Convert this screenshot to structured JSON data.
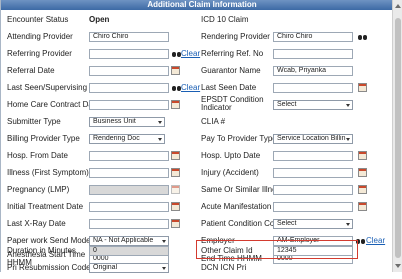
{
  "title": "Additional Claim Information",
  "clear_link": "Clear",
  "fields": {
    "encounter_status": {
      "label": "Encounter Status",
      "value": "Open"
    },
    "icd10_claim": {
      "label": "ICD 10 Claim"
    },
    "attending_provider": {
      "label": "Attending Provider",
      "value": "Chiro Chiro"
    },
    "rendering_provider": {
      "label": "Rendering Provider",
      "value": "Chiro Chiro"
    },
    "referring_provider": {
      "label": "Referring Provider",
      "value": ""
    },
    "referring_ref_no": {
      "label": "Referring Ref. No",
      "value": ""
    },
    "referral_date": {
      "label": "Referral Date",
      "value": ""
    },
    "guarantor_name": {
      "label": "Guarantor Name",
      "value": "Wcab, Priyanka"
    },
    "last_seen_supervising_doc": {
      "label": "Last Seen/Supervising Doc",
      "value": ""
    },
    "last_seen_date": {
      "label": "Last Seen Date",
      "value": ""
    },
    "home_care_contract_date": {
      "label": "Home Care Contract Date",
      "value": ""
    },
    "epsdt_condition_indicator": {
      "label": "EPSDT Condition Indicator",
      "value": "Select"
    },
    "submitter_type": {
      "label": "Submitter Type",
      "value": "Business Unit"
    },
    "clia": {
      "label": "CLIA #"
    },
    "billing_provider_type": {
      "label": "Billing Provider Type",
      "value": "Rendering Doc"
    },
    "pay_to_provider_type": {
      "label": "Pay To Provider Type",
      "value": "Service Location Billin"
    },
    "hosp_from_date": {
      "label": "Hosp. From Date",
      "value": ""
    },
    "hosp_upto_date": {
      "label": "Hosp. Upto Date",
      "value": ""
    },
    "illness_first_symptom": {
      "label": "Illness (First Symptom)",
      "value": ""
    },
    "injury_accident": {
      "label": "Injury (Accident)",
      "value": ""
    },
    "pregnancy_lmp": {
      "label": "Pregnancy (LMP)",
      "value": ""
    },
    "same_or_similar_illness": {
      "label": "Same Or Similar Illness",
      "value": ""
    },
    "initial_treatment_date": {
      "label": "Initial Treatment Date",
      "value": ""
    },
    "acute_manifestation_date": {
      "label": "Acute Manifestation Date",
      "value": ""
    },
    "last_xray_date": {
      "label": "Last X-Ray Date",
      "value": ""
    },
    "patient_condition_code": {
      "label": "Patient Condition Code",
      "value": "Select"
    },
    "paper_work_send_mode": {
      "label": "Paper work Send Mode",
      "value": "NA - Not Applicable"
    },
    "employer": {
      "label": "Employer",
      "value": "AM-Employer"
    },
    "anesthesia_start_time": {
      "label": "Anesthesia Start Time HHMM",
      "value": "0000"
    },
    "end_time": {
      "label": "End Time HHMM",
      "value": "0000"
    },
    "duration_in_minutes": {
      "label": "Duration in Minutes",
      "value": "0"
    },
    "other_claim_id": {
      "label": "Other Claim Id",
      "value": "12345"
    },
    "pri_resubmission_code": {
      "label": "Pri Resubmission Code",
      "value": "Original"
    },
    "dcn_icn_pri": {
      "label": "DCN ICN Pri"
    }
  }
}
